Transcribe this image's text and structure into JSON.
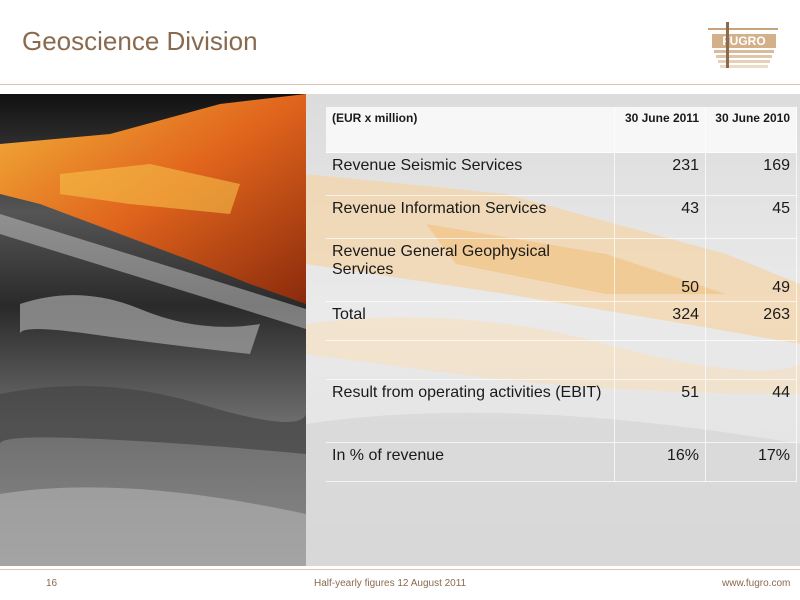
{
  "header": {
    "title": "Geoscience Division",
    "logo_text": "FUGRO"
  },
  "table": {
    "header": {
      "label": "(EUR x million)",
      "col1": "30 June 2011",
      "col2": "30 June 2010"
    },
    "rows": [
      {
        "label": "Revenue Seismic Services",
        "v2011": "231",
        "v2010": "169"
      },
      {
        "label": "Revenue Information Services",
        "v2011": "43",
        "v2010": "45"
      },
      {
        "label": "Revenue General Geophysical Services",
        "v2011": "50",
        "v2010": "49"
      },
      {
        "label": "Total",
        "v2011": "324",
        "v2010": "263"
      },
      {
        "label": "Result from operating activities (EBIT)",
        "v2011": "51",
        "v2010": "44"
      },
      {
        "label": "In % of revenue",
        "v2011": "16%",
        "v2010": "17%"
      }
    ]
  },
  "footer": {
    "page": "16",
    "subtitle": "Half-yearly figures 12 August 2011",
    "url": "www.fugro.com"
  },
  "colors": {
    "accent": "#8a6a4e",
    "logo": "#c9a27a"
  }
}
